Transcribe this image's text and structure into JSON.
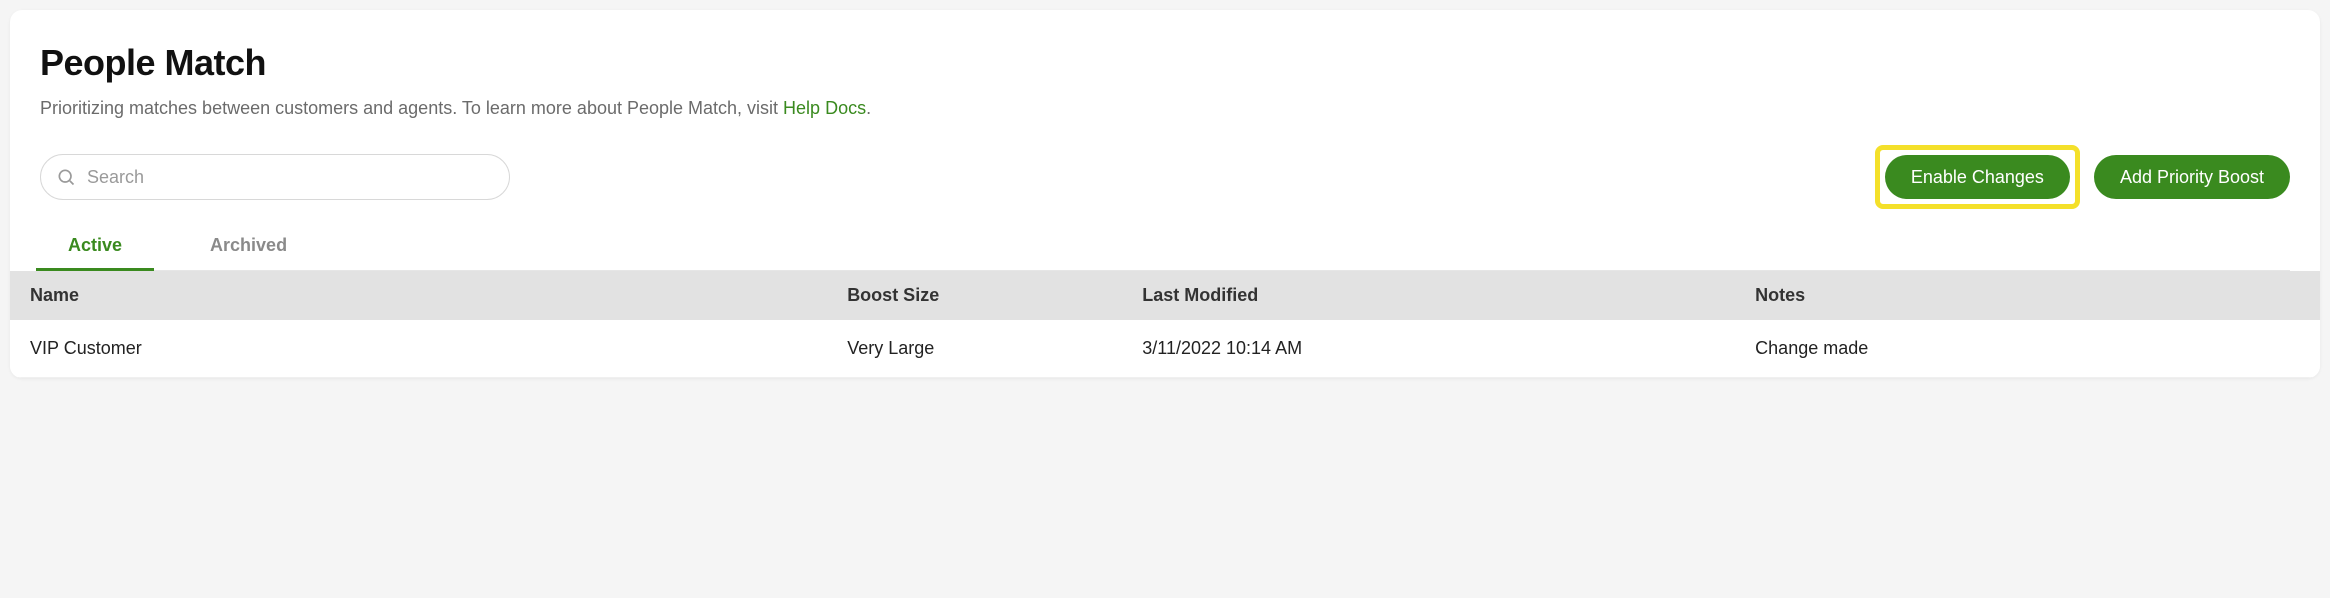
{
  "page": {
    "title": "People Match",
    "subtitle_prefix": "Prioritizing matches between customers and agents. To learn more about People Match, visit ",
    "subtitle_link": "Help Docs",
    "subtitle_suffix": "."
  },
  "search": {
    "placeholder": "Search",
    "value": ""
  },
  "buttons": {
    "enable_changes": "Enable Changes",
    "add_priority_boost": "Add Priority Boost"
  },
  "tabs": {
    "active": "Active",
    "archived": "Archived"
  },
  "table": {
    "headers": {
      "name": "Name",
      "boost_size": "Boost Size",
      "last_modified": "Last Modified",
      "notes": "Notes"
    },
    "rows": [
      {
        "name": "VIP Customer",
        "boost_size": "Very Large",
        "last_modified": "3/11/2022 10:14 AM",
        "notes": "Change made"
      }
    ]
  },
  "colors": {
    "accent": "#3a8a1f",
    "highlight": "#f4e02a"
  }
}
